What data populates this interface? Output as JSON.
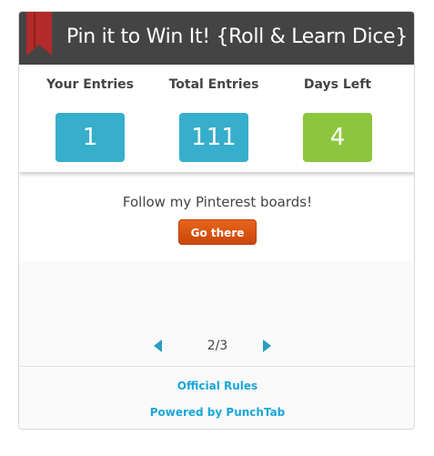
{
  "header": {
    "title": "Pin it to Win It! {Roll & Learn Dice}",
    "ribbon_icon": "bookmark-ribbon-icon",
    "ribbon_color": "#b22a2a"
  },
  "stats": [
    {
      "label": "Your Entries",
      "value": "1",
      "color": "#37aecb"
    },
    {
      "label": "Total Entries",
      "value": "111",
      "color": "#37aecb"
    },
    {
      "label": "Days Left",
      "value": "4",
      "color": "#8cc63f"
    }
  ],
  "promo": {
    "text": "Follow my Pinterest boards!",
    "button_label": "Go there",
    "button_color": "#d9560f"
  },
  "pager": {
    "current": "2/3",
    "prev_icon": "chevron-left-icon",
    "next_icon": "chevron-right-icon"
  },
  "footer": {
    "rules_label": "Official Rules",
    "powered_label": "Powered by PunchTab",
    "link_color": "#1aa6d9"
  }
}
